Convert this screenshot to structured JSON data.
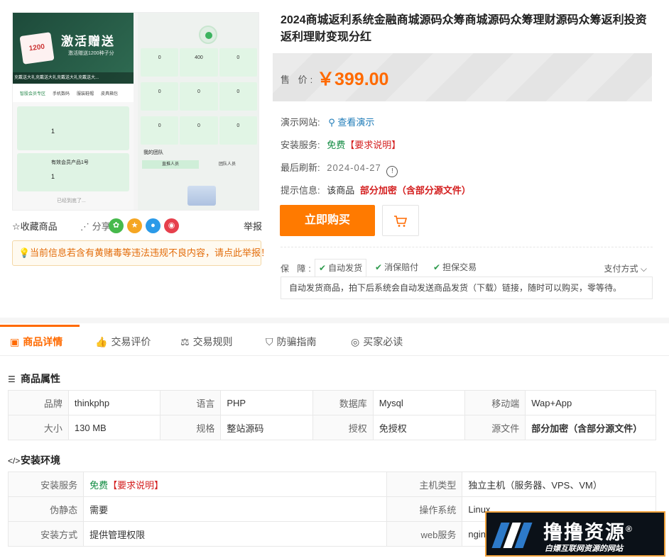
{
  "gallery": {
    "banner_title": "激活赠送",
    "banner_sub": "激活赠送1200种子分",
    "card_value": "1200",
    "strip_text": "充戴送大礼充戴送大礼充戴送大礼充戴送大...",
    "tabs": [
      "智股会员专区",
      "手机数码",
      "服装鞋帽",
      "皮具箱包"
    ],
    "card1_val": "1",
    "card2_title": "有效会员产品1号",
    "card2_val": "1",
    "loaded": "已经到底了...",
    "stats_row1": [
      "0",
      "400",
      "0"
    ],
    "stats_row2": [
      "0",
      "0",
      "0"
    ],
    "stats_row3": [
      "0",
      "0",
      "0"
    ],
    "team_title": "我的团队",
    "team_tabs": [
      "直推人员",
      "团队人员"
    ]
  },
  "actions": {
    "favorite": "☆收藏商品",
    "share": "分享:",
    "report": "举报"
  },
  "notice": "当前信息若含有黄赌毒等违法违规不良内容，请点此举报！",
  "product": {
    "title": "2024商城返利系统金融商城源码众筹商城源码众筹理财源码众筹返利投资返利理财变现分红",
    "price_label": "售 价:",
    "price": "￥399.00",
    "demo_label": "演示网站:",
    "demo_link": "查看演示",
    "install_label": "安装服务:",
    "install_free": "免费",
    "install_note": "【要求说明】",
    "refresh_label": "最后刷新:",
    "refresh_date": "2024-04-27",
    "tip_label": "提示信息:",
    "tip_text": "该商品",
    "tip_red": "部分加密（含部分源文件）",
    "buy": "立即购买"
  },
  "guarantee": {
    "label": "保 障:",
    "items": [
      "自动发货",
      "消保赔付",
      "担保交易"
    ],
    "pay": "支付方式",
    "desc": "自动发货商品，拍下后系统会自动发送商品发货（下载）链接，随时可以购买，零等待。"
  },
  "nav": [
    "商品详情",
    "交易评价",
    "交易规则",
    "防骗指南",
    "买家必读"
  ],
  "attributes": {
    "title": "商品属性",
    "rows": [
      [
        "品牌",
        "thinkphp",
        "语言",
        "PHP",
        "数据库",
        "Mysql",
        "移动端",
        "Wap+App"
      ],
      [
        "大小",
        "130 MB",
        "规格",
        "整站源码",
        "授权",
        "免授权",
        "源文件",
        "部分加密（含部分源文件）"
      ]
    ]
  },
  "environment": {
    "title": "安装环境",
    "rows": [
      [
        "安装服务",
        "免费",
        "【要求说明】",
        "主机类型",
        "独立主机（服务器、VPS、VM）"
      ],
      [
        "伪静态",
        "需要",
        "",
        "操作系统",
        "Linux"
      ],
      [
        "安装方式",
        "提供管理权限",
        "",
        "web服务",
        "nginx"
      ]
    ]
  },
  "watermark": {
    "main": "撸撸资源",
    "reg": "®",
    "sub": "白嫖互联网资源的网站"
  },
  "colors": {
    "accent": "#ff6a00",
    "green": "#0e8a3f",
    "red": "#d41f1f"
  }
}
